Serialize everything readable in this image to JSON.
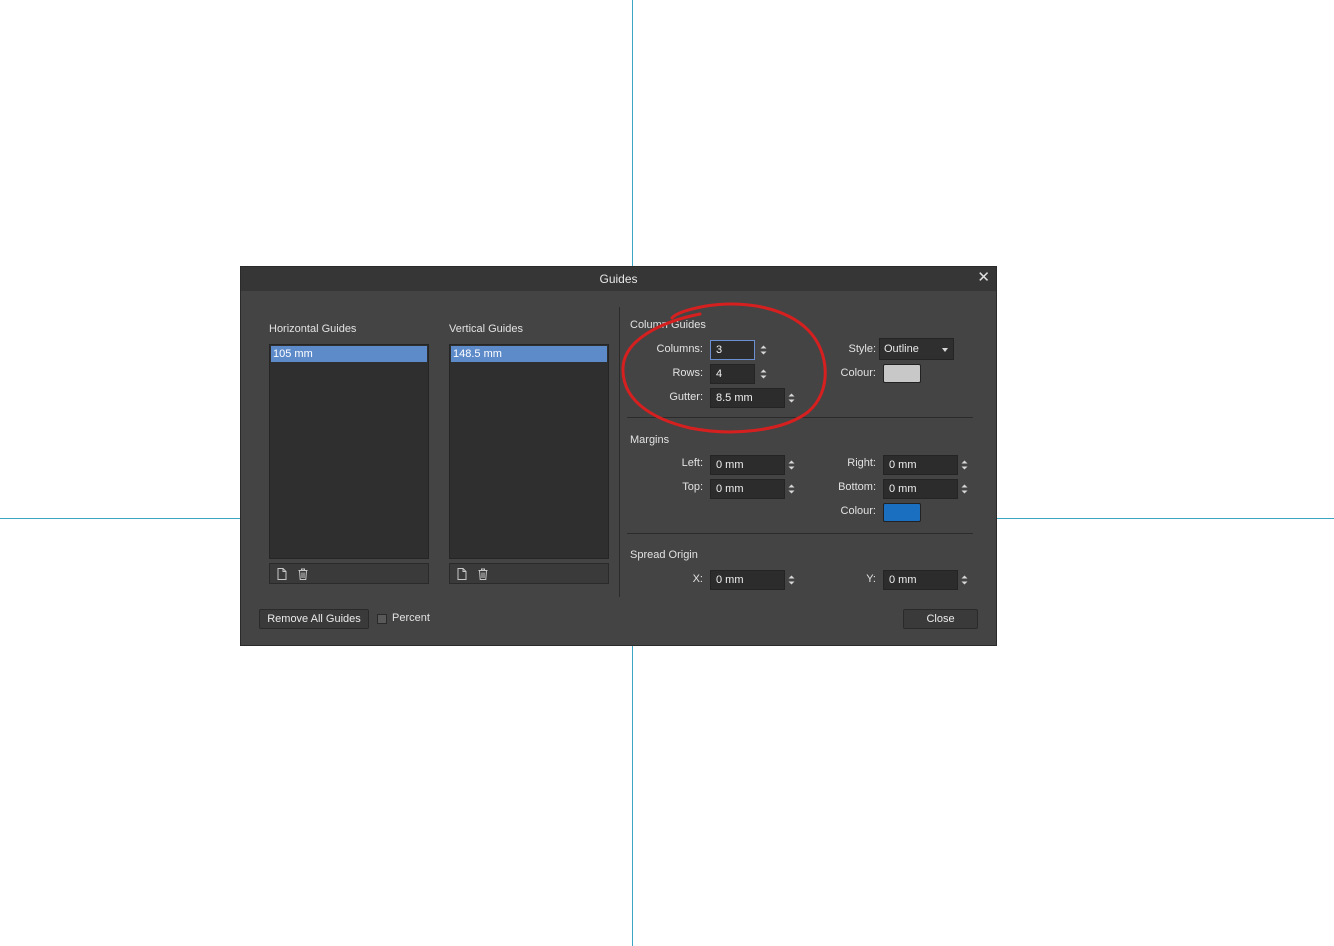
{
  "dialog": {
    "title": "Guides",
    "close_glyph": "✕"
  },
  "horizontal_guides": {
    "label": "Horizontal Guides",
    "items": [
      "105 mm"
    ]
  },
  "vertical_guides": {
    "label": "Vertical Guides",
    "items": [
      "148.5 mm"
    ]
  },
  "column_guides": {
    "heading": "Column Guides",
    "columns_label": "Columns:",
    "columns_value": "3",
    "rows_label": "Rows:",
    "rows_value": "4",
    "gutter_label": "Gutter:",
    "gutter_value": "8.5 mm",
    "style_label": "Style:",
    "style_value": "Outline",
    "colour_label": "Colour:",
    "colour_value": "#c8c8c8"
  },
  "margins": {
    "heading": "Margins",
    "left_label": "Left:",
    "left_value": "0 mm",
    "right_label": "Right:",
    "right_value": "0 mm",
    "top_label": "Top:",
    "top_value": "0 mm",
    "bottom_label": "Bottom:",
    "bottom_value": "0 mm",
    "colour_label": "Colour:",
    "colour_value": "#1a6fc0"
  },
  "spread_origin": {
    "heading": "Spread Origin",
    "x_label": "X:",
    "x_value": "0 mm",
    "y_label": "Y:",
    "y_value": "0 mm"
  },
  "footer": {
    "remove_all_label": "Remove All Guides",
    "percent_label": "Percent",
    "close_label": "Close"
  },
  "colors": {
    "guide_line": "#3aa6c4",
    "dialog_bg": "#444444",
    "selection": "#5d8ac9",
    "annotation": "#d62020"
  }
}
